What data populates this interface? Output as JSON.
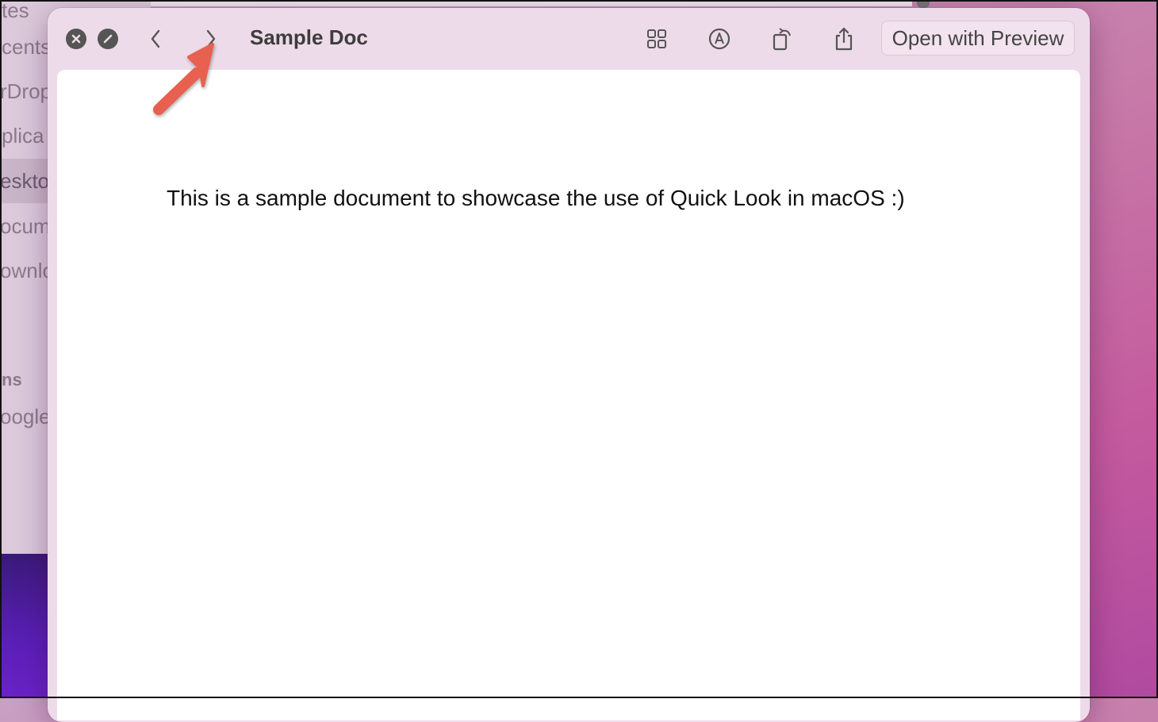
{
  "finder": {
    "sidebar_items": [
      "tes",
      "cents",
      "rDrop",
      "plica",
      "eskto",
      "ocum",
      "ownlo",
      "ns",
      "oogle"
    ]
  },
  "window": {
    "title": "Sample Doc",
    "open_button": "Open with Preview",
    "document_text": "This is a sample document to showcase the use of Quick Look in macOS :)"
  },
  "colors": {
    "annotation_arrow": "#e8604f",
    "window_bg": "#eedbe9"
  },
  "icons": {
    "close": "close-icon",
    "fullscreen": "fullscreen-icon",
    "back": "chevron-left-icon",
    "forward": "chevron-right-icon",
    "grid": "grid-icon",
    "markup": "markup-icon",
    "rotate": "rotate-icon",
    "share": "share-icon",
    "annotation": "arrow-annotation-icon"
  }
}
